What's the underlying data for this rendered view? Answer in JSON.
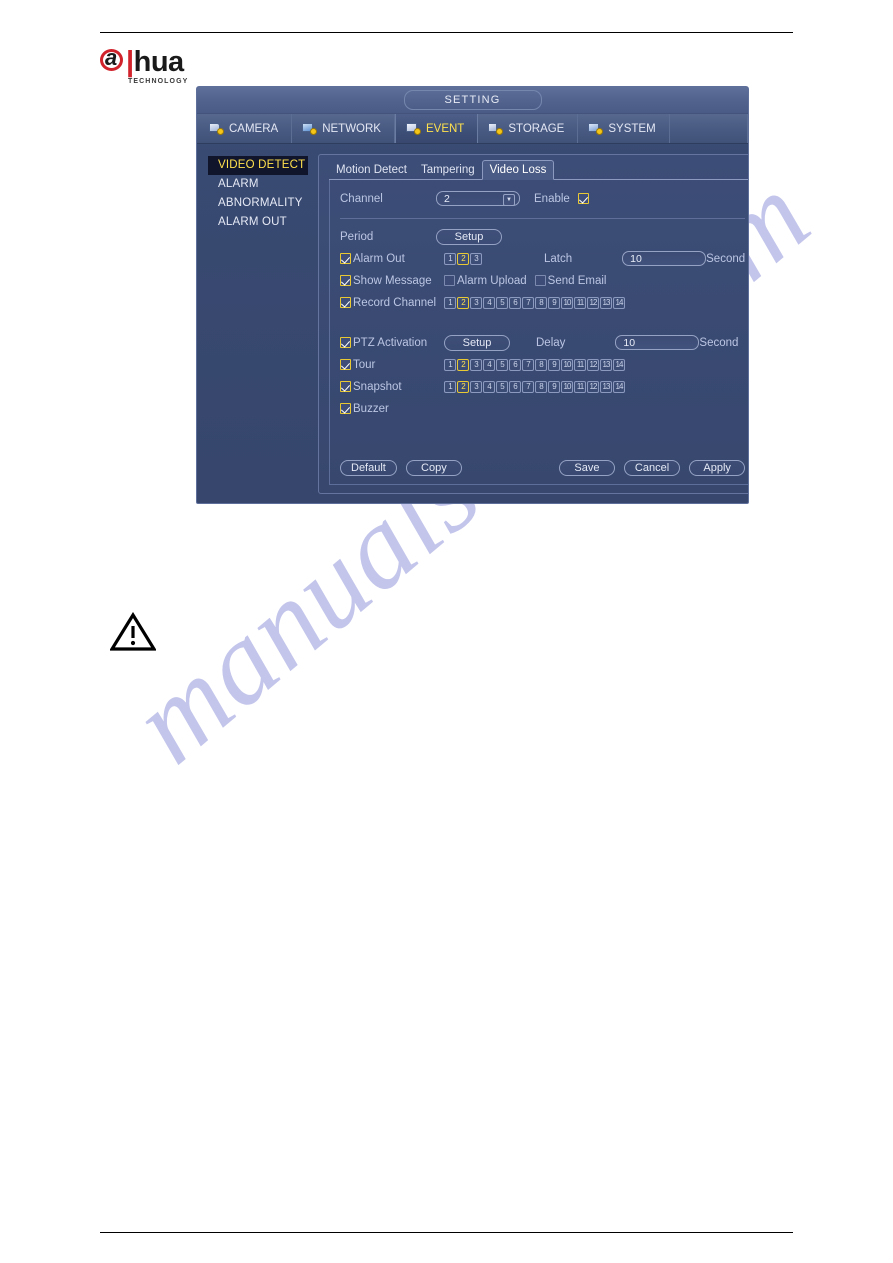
{
  "logo": {
    "brand": "hua",
    "letter": "a",
    "slash": "|",
    "tagline": "TECHNOLOGY"
  },
  "window": {
    "title": "SETTING"
  },
  "main_tabs": [
    {
      "label": "CAMERA",
      "icon": "camera-icon",
      "active": false
    },
    {
      "label": "NETWORK",
      "icon": "network-icon",
      "active": false
    },
    {
      "label": "EVENT",
      "icon": "event-icon",
      "active": true
    },
    {
      "label": "STORAGE",
      "icon": "storage-icon",
      "active": false
    },
    {
      "label": "SYSTEM",
      "icon": "system-icon",
      "active": false
    }
  ],
  "sidebar": {
    "items": [
      {
        "label": "VIDEO DETECT",
        "active": true
      },
      {
        "label": "ALARM",
        "active": false
      },
      {
        "label": "ABNORMALITY",
        "active": false
      },
      {
        "label": "ALARM OUT",
        "active": false
      }
    ]
  },
  "sub_tabs": [
    {
      "label": "Motion Detect",
      "active": false
    },
    {
      "label": "Tampering",
      "active": false
    },
    {
      "label": "Video Loss",
      "active": true
    }
  ],
  "form": {
    "channel_label": "Channel",
    "channel_value": "2",
    "enable_label": "Enable",
    "enable_checked": true,
    "period_label": "Period",
    "period_setup_label": "Setup",
    "alarm_out_label": "Alarm Out",
    "alarm_out_checked": true,
    "alarm_out_channels": [
      "1",
      "2",
      "3"
    ],
    "alarm_out_selected": [
      "2"
    ],
    "latch_label": "Latch",
    "latch_value": "10",
    "latch_unit": "Second",
    "show_message_label": "Show Message",
    "show_message_checked": true,
    "alarm_upload_label": "Alarm Upload",
    "alarm_upload_checked": false,
    "send_email_label": "Send Email",
    "send_email_checked": false,
    "record_channel_label": "Record Channel",
    "record_channel_checked": true,
    "record_channels": [
      "1",
      "2",
      "3",
      "4",
      "5",
      "6",
      "7",
      "8",
      "9",
      "10",
      "11",
      "12",
      "13",
      "14"
    ],
    "record_channel_selected": [
      "2"
    ],
    "ptz_activation_label": "PTZ Activation",
    "ptz_activation_checked": true,
    "ptz_setup_label": "Setup",
    "delay_label": "Delay",
    "delay_value": "10",
    "delay_unit": "Second",
    "tour_label": "Tour",
    "tour_checked": true,
    "tour_channels": [
      "1",
      "2",
      "3",
      "4",
      "5",
      "6",
      "7",
      "8",
      "9",
      "10",
      "11",
      "12",
      "13",
      "14"
    ],
    "tour_selected": [
      "2"
    ],
    "snapshot_label": "Snapshot",
    "snapshot_checked": true,
    "snapshot_channels": [
      "1",
      "2",
      "3",
      "4",
      "5",
      "6",
      "7",
      "8",
      "9",
      "10",
      "11",
      "12",
      "13",
      "14"
    ],
    "snapshot_selected": [
      "2"
    ],
    "buzzer_label": "Buzzer",
    "buzzer_checked": true
  },
  "footer_buttons": {
    "default_label": "Default",
    "copy_label": "Copy",
    "save_label": "Save",
    "cancel_label": "Cancel",
    "apply_label": "Apply"
  },
  "watermark": {
    "text": "manualshive.com"
  },
  "colors": {
    "accent_yellow": "#ffe14d",
    "panel_blue": "#3c4d77",
    "border_blue": "#95a2c4",
    "brand_red": "#d0232b",
    "watermark": "#b9bce8"
  }
}
